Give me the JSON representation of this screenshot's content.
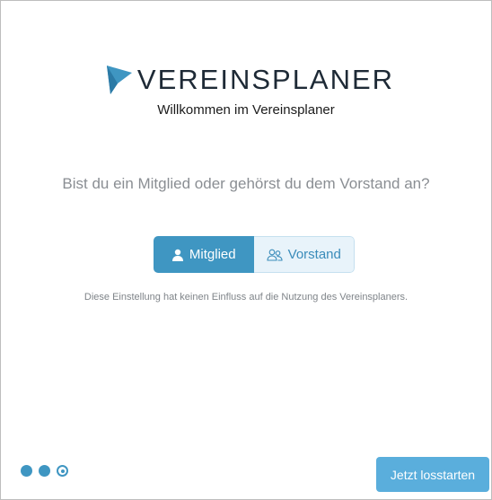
{
  "logo": {
    "wordmark": "VEREINSPLANER",
    "mark_icon": "flag-logo-icon"
  },
  "header": {
    "tagline": "Willkommen im Vereinsplaner"
  },
  "main": {
    "question": "Bist du ein Mitglied oder gehörst du dem Vorstand an?",
    "options": [
      {
        "label": "Mitglied",
        "icon": "user-icon",
        "selected": true
      },
      {
        "label": "Vorstand",
        "icon": "users-group-icon",
        "selected": false
      }
    ],
    "hint": "Diese Einstellung hat keinen Einfluss auf die Nutzung des Vereinsplaners."
  },
  "footer": {
    "steps_total": 3,
    "step_current": 3,
    "start_label": "Jetzt losstarten"
  },
  "colors": {
    "accent": "#3f96c2",
    "button": "#5aaedc",
    "inactive_bg": "#e8f3fa"
  }
}
